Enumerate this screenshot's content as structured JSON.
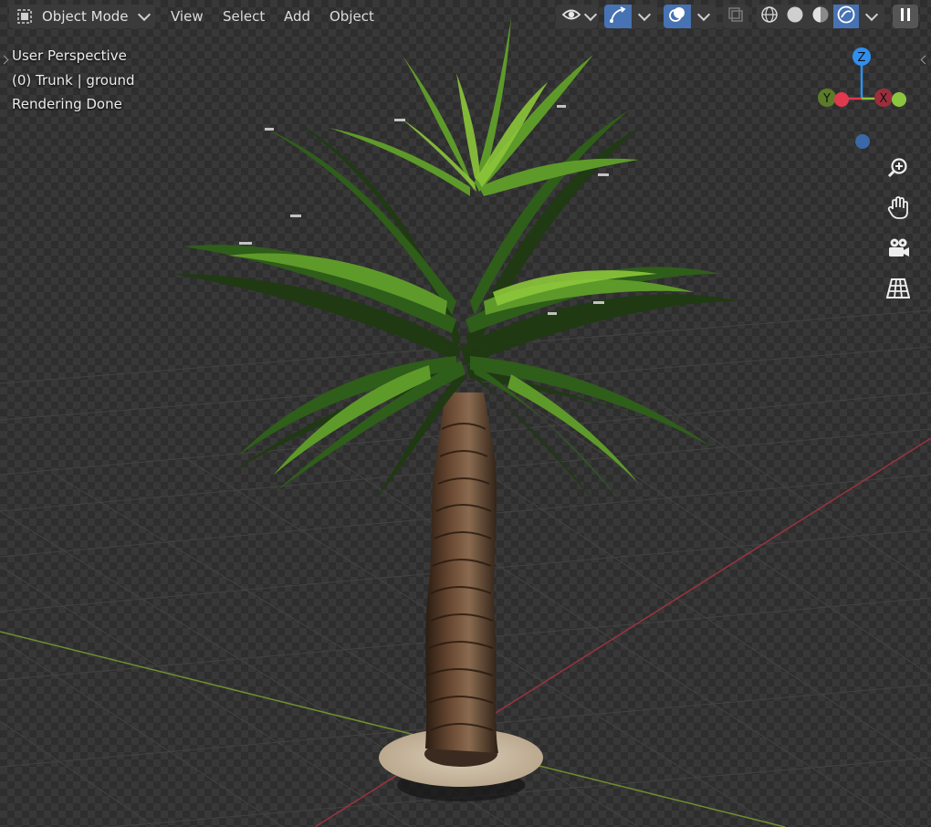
{
  "header": {
    "mode_label": "Object Mode",
    "menus": [
      "View",
      "Select",
      "Add",
      "Object"
    ]
  },
  "overlay": {
    "perspective": "User Perspective",
    "object": "(0) Trunk | ground",
    "status": "Rendering Done"
  },
  "gizmo": {
    "z_label": "Z",
    "y_label": "Y",
    "x_label": "X",
    "colors": {
      "x": "#e03a4f",
      "y": "#8bc53f",
      "z": "#2f8ff0",
      "neg_z": "#3a68a8"
    }
  },
  "icons": {
    "mode": "object-mode-icon",
    "visibility": "eye-icon",
    "gizmo": "gizmo-arrows-icon",
    "overlays": "overlays-icon",
    "xray": "xray-icon",
    "shading": [
      "wireframe-icon",
      "solid-icon",
      "material-preview-icon",
      "rendered-icon"
    ],
    "pause": "pause-icon",
    "nav": [
      "zoom-icon",
      "hand-pan-icon",
      "camera-icon",
      "grid-perspective-icon"
    ]
  }
}
